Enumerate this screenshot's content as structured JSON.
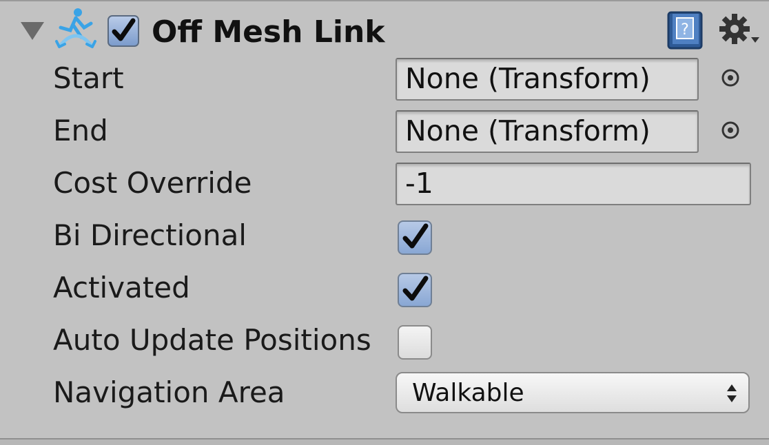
{
  "component": {
    "title": "Off Mesh Link",
    "enabled": true,
    "icons": {
      "foldout": "foldout-expanded-arrow",
      "component": "off-mesh-link-icon",
      "help": "help-book-icon",
      "settings": "gear-icon"
    }
  },
  "fields": {
    "start": {
      "label": "Start",
      "value": "None (Transform)"
    },
    "end": {
      "label": "End",
      "value": "None (Transform)"
    },
    "cost_override": {
      "label": "Cost Override",
      "value": "-1"
    },
    "bi_directional": {
      "label": "Bi Directional",
      "checked": true
    },
    "activated": {
      "label": "Activated",
      "checked": true
    },
    "auto_update_positions": {
      "label": "Auto Update Positions",
      "checked": false
    },
    "navigation_area": {
      "label": "Navigation Area",
      "value": "Walkable"
    }
  },
  "colors": {
    "panel_bg": "#c2c2c2",
    "check_blue": "#89a7d4",
    "field_bg": "#dadada"
  }
}
